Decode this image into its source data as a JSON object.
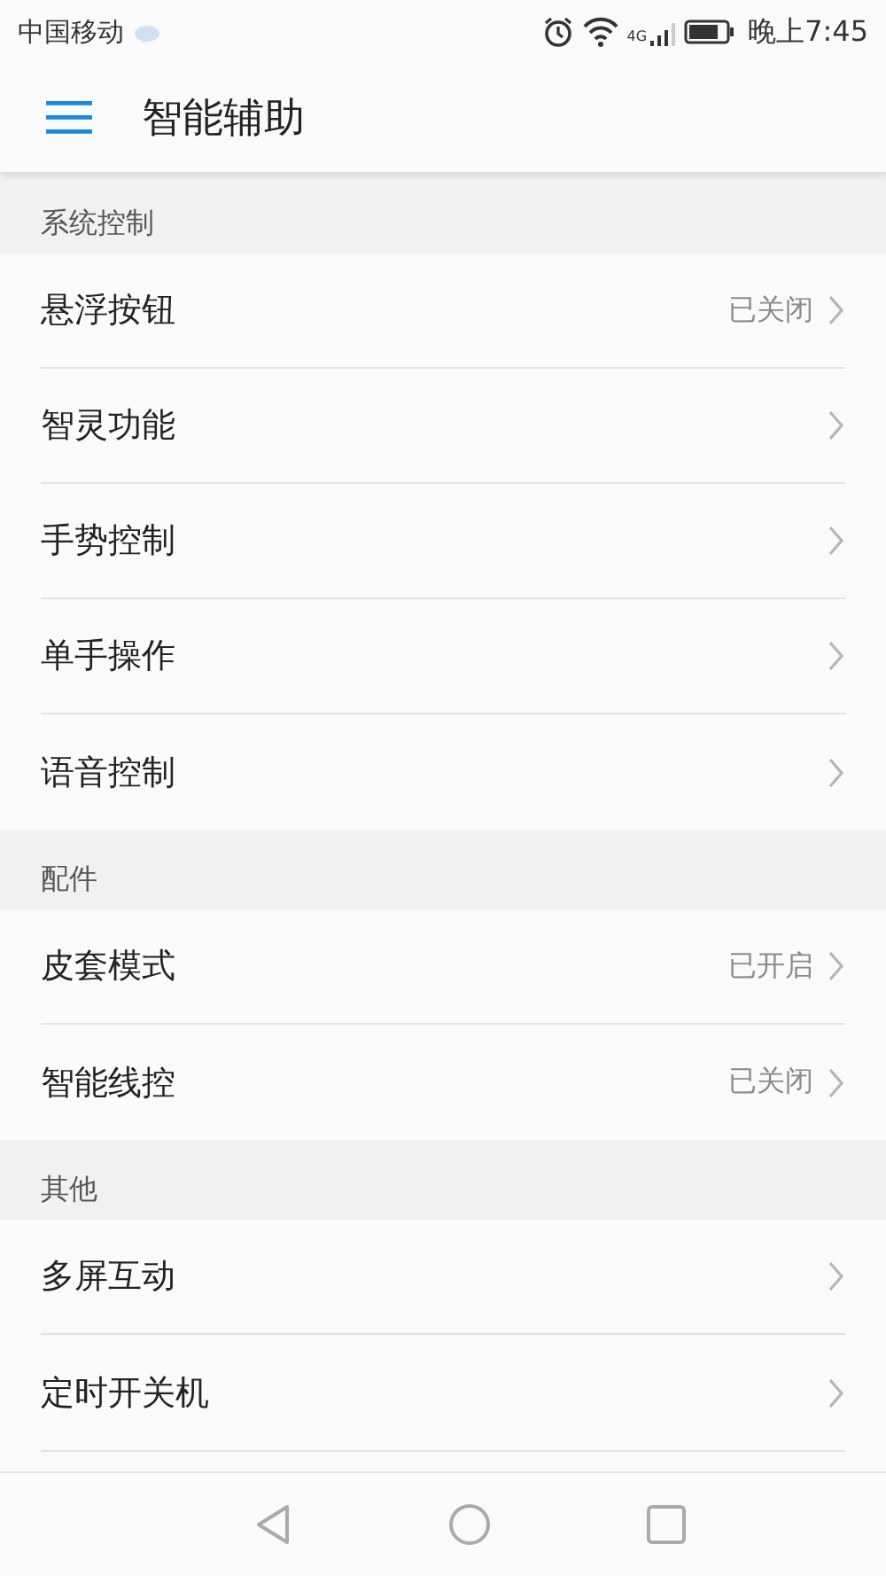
{
  "status_bar": {
    "carrier": "中国移动",
    "network": "4G",
    "time": "晚上7:45"
  },
  "header": {
    "title": "智能辅助"
  },
  "sections": [
    {
      "title": "系统控制",
      "items": [
        {
          "label": "悬浮按钮",
          "value": "已关闭"
        },
        {
          "label": "智灵功能"
        },
        {
          "label": "手势控制"
        },
        {
          "label": "单手操作"
        },
        {
          "label": "语音控制"
        }
      ]
    },
    {
      "title": "配件",
      "items": [
        {
          "label": "皮套模式",
          "value": "已开启"
        },
        {
          "label": "智能线控",
          "value": "已关闭"
        }
      ]
    },
    {
      "title": "其他",
      "items": [
        {
          "label": "多屏互动"
        },
        {
          "label": "定时开关机"
        }
      ]
    }
  ]
}
